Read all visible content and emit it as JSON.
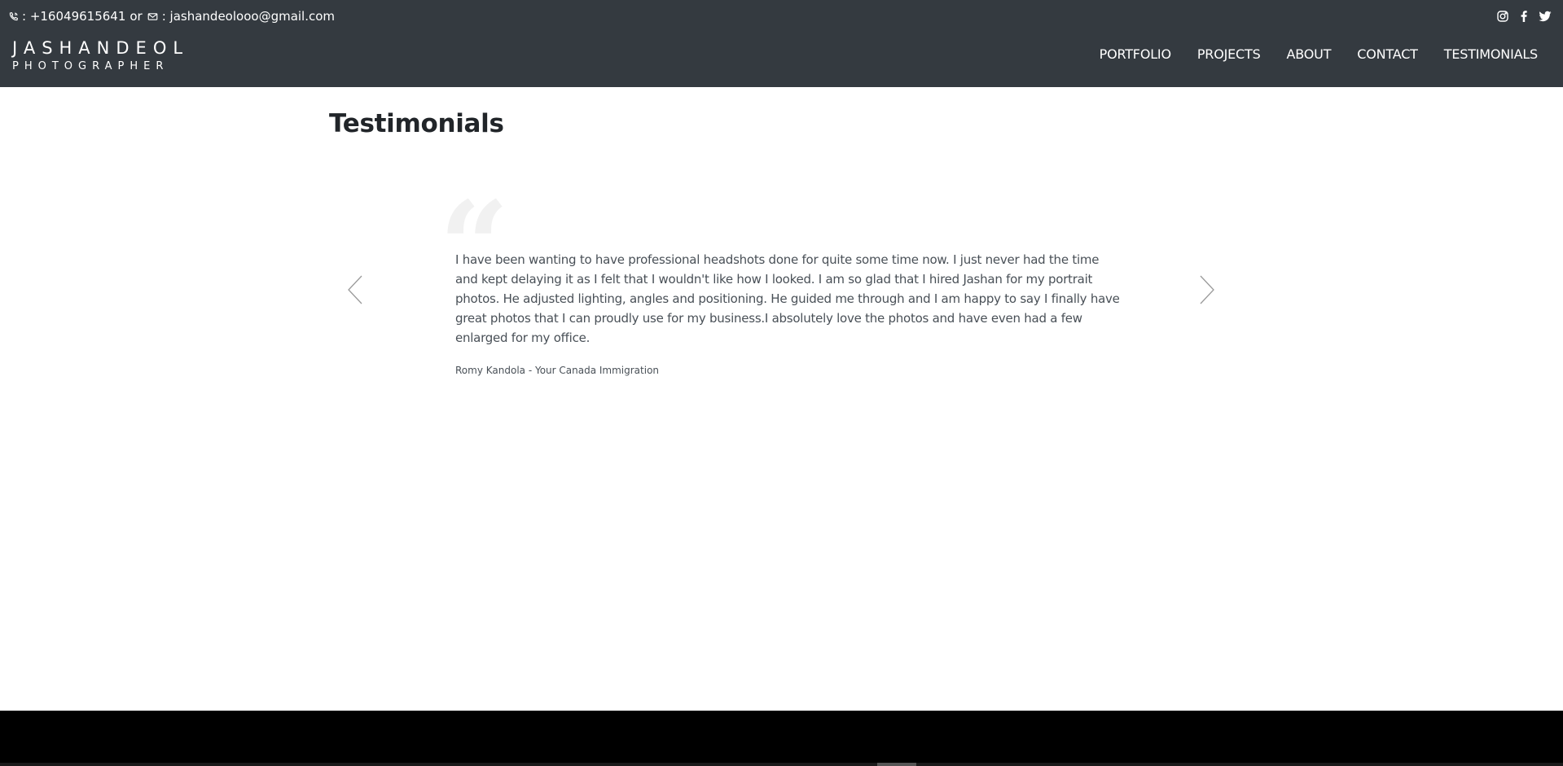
{
  "contact": {
    "phone_text": ": +16049615641",
    "or_text": "or",
    "email_text": ": jashandeolooo@gmail.com"
  },
  "social": [
    "instagram-icon",
    "facebook-icon",
    "twitter-icon"
  ],
  "brand": {
    "name": "JASHANDEOL",
    "role": "PHOTOGRAPHER"
  },
  "nav": {
    "items": [
      {
        "label": "PORTFOLIO"
      },
      {
        "label": "PROJECTS"
      },
      {
        "label": "ABOUT"
      },
      {
        "label": "CONTACT"
      },
      {
        "label": "TESTIMONIALS"
      }
    ]
  },
  "page": {
    "title": "Testimonials"
  },
  "testimonial": {
    "quote_glyph": "“",
    "text": "I have been wanting to have professional headshots done for quite some time now. I just never had the time and kept delaying it as I felt that I wouldn't like how I looked. I am so glad that I hired Jashan for my portrait photos. He adjusted lighting, angles and positioning. He guided me through and I am happy to say I finally have great photos that I can proudly use for my business.I absolutely love the photos and have even had a few enlarged for my office.",
    "author": "Romy Kandola - Your Canada Immigration"
  },
  "colors": {
    "header_bg": "#343a40",
    "footer_bg": "#000000",
    "title": "#212529",
    "body_text": "#495057",
    "quote_mark": "#f1f1f1"
  }
}
